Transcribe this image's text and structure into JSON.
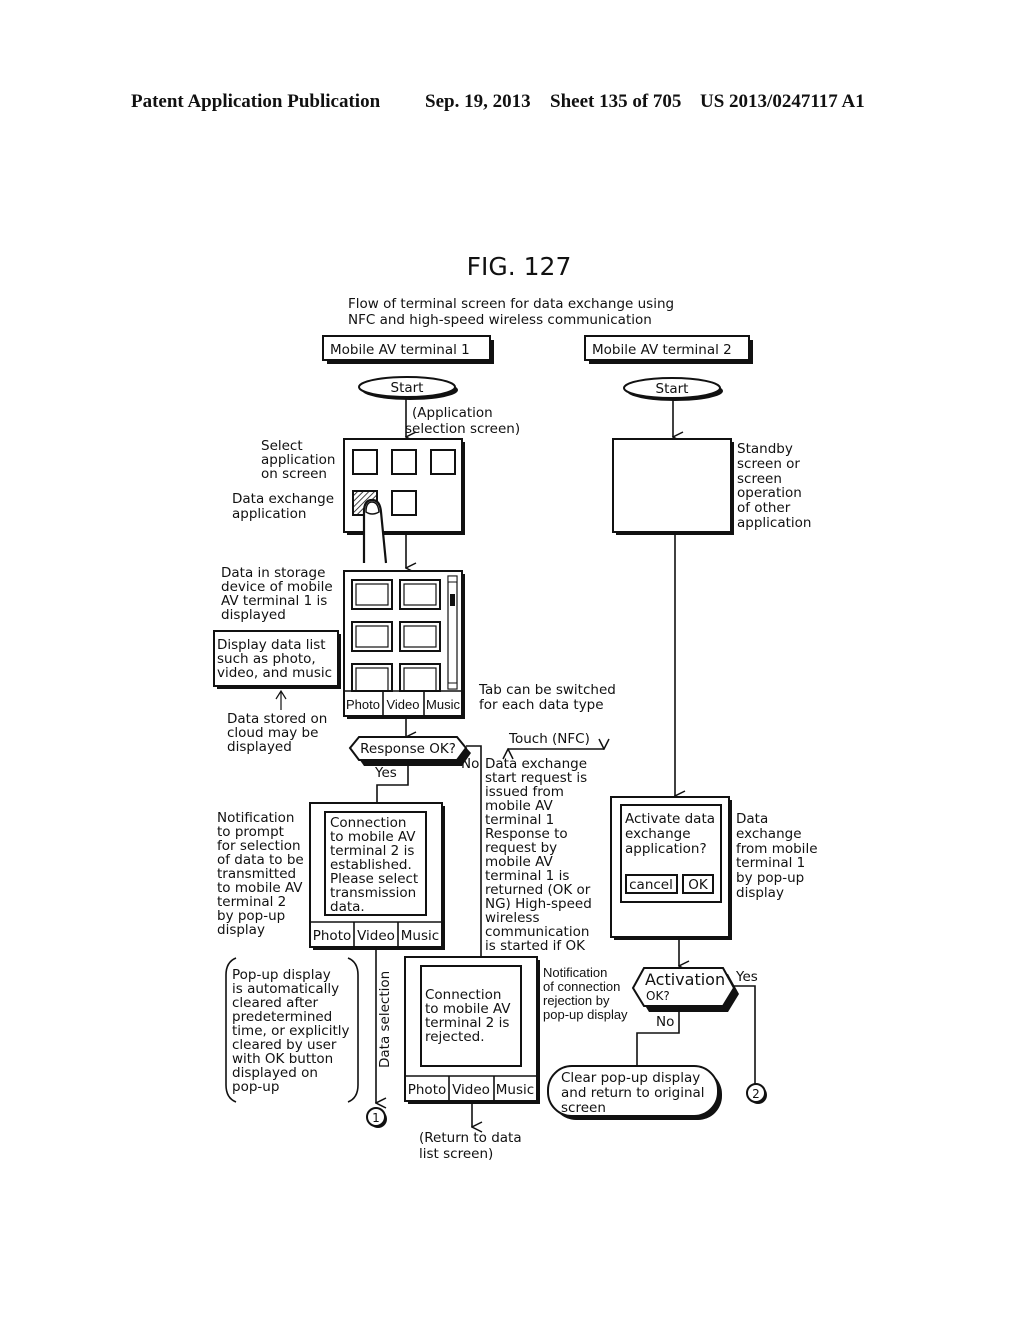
{
  "header": {
    "publication": "Patent Application Publication",
    "date": "Sep. 19, 2013",
    "sheet": "Sheet 135 of 705",
    "number": "US 2013/0247117 A1"
  },
  "figure": {
    "title": "FIG. 127",
    "caption": [
      "Flow of terminal screen for data exchange using",
      "NFC and high-speed wireless communication"
    ]
  },
  "terminal1": {
    "label": "Mobile AV terminal 1",
    "start": "Start",
    "app_selection_note": [
      "(Application",
      "selection screen)"
    ],
    "select_app_note": [
      "Select",
      "application",
      "on screen"
    ],
    "data_exchange_app_note": [
      "Data exchange",
      "application"
    ],
    "storage_note": [
      "Data in storage",
      "device of mobile",
      "AV terminal 1 is",
      "displayed"
    ],
    "display_list_box": [
      "Display data list",
      "such as photo,",
      "video, and music"
    ],
    "cloud_note": [
      "Data stored on",
      "cloud may be",
      "displayed"
    ],
    "tabs": [
      "Photo",
      "Video",
      "Music"
    ],
    "tab_note": [
      "Tab can be switched",
      "for each data type"
    ],
    "decision": "Response OK?",
    "yes": "Yes",
    "no": "No",
    "request_note": [
      "Data exchange",
      "start request is",
      "issued from",
      "mobile AV",
      "terminal 1",
      "Response to",
      "request by",
      "mobile AV",
      "terminal 1 is",
      "returned (OK or",
      "NG) High-speed",
      "wireless",
      "communication",
      "is started if OK"
    ],
    "prompt_note": [
      "Notification",
      "to prompt",
      "for selection",
      "of data to be",
      "transmitted",
      "to mobile AV",
      "terminal 2",
      "by pop-up",
      "display"
    ],
    "established_popup": [
      "Connection",
      "to mobile AV",
      "terminal 2 is",
      "established.",
      "Please select",
      "transmission",
      "data."
    ],
    "clear_note": [
      "Pop-up display",
      "is automatically",
      "cleared after",
      "predetermined",
      "time, or explicitly",
      "cleared by user",
      "with OK button",
      "displayed on",
      "pop-up"
    ],
    "data_selection": "Data selection",
    "connector1": "1",
    "rejected_popup": [
      "Connection",
      "to mobile AV",
      "terminal 2 is",
      "rejected."
    ],
    "rejection_note": [
      "Notification",
      "of connection",
      "rejection by",
      "pop-up display"
    ],
    "return_note": [
      "(Return to data",
      "list screen)"
    ]
  },
  "nfc": {
    "label": "Touch (NFC)"
  },
  "terminal2": {
    "label": "Mobile AV terminal 2",
    "start": "Start",
    "standby_note": [
      "Standby",
      "screen or",
      "screen",
      "operation",
      "of other",
      "application"
    ],
    "activate_popup": [
      "Activate data",
      "exchange",
      "application?"
    ],
    "cancel_button": "cancel",
    "ok_button": "OK",
    "popup_note": [
      "Data",
      "exchange",
      "from mobile",
      "terminal 1",
      "by pop-up",
      "display"
    ],
    "decision": [
      "Activation",
      "OK?"
    ],
    "yes": "Yes",
    "no": "No",
    "clear_terminal": [
      "Clear pop-up display",
      "and return to original",
      "screen"
    ],
    "connector2": "2"
  }
}
